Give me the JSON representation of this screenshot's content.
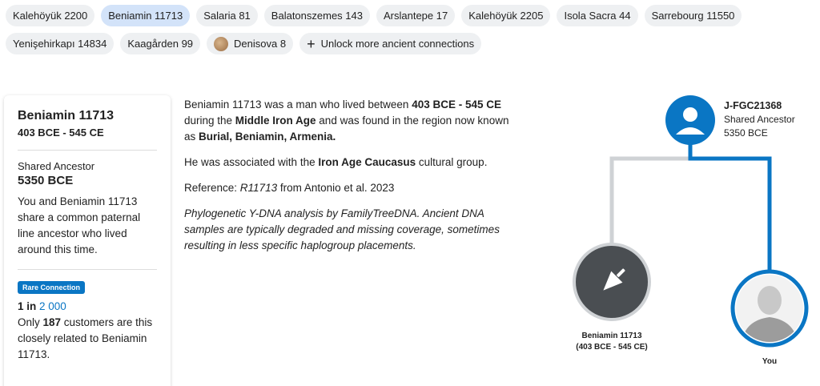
{
  "chips": {
    "row1": [
      "Kalehöyük 2200",
      "Beniamin 11713",
      "Salaria 81",
      "Balatonszemes 143",
      "Arslantepe 17",
      "Kalehöyük 2205",
      "Isola Sacra 44",
      "Sarrebourg 11550"
    ],
    "row2": [
      "Yenişehirkapı 14834",
      "Kaagården 99",
      "Denisova 8"
    ],
    "unlock_label": "Unlock more ancient connections"
  },
  "card": {
    "name": "Beniamin 11713",
    "dates": "403 BCE - 545 CE",
    "shared_label": "Shared Ancestor",
    "shared_value": "5350 BCE",
    "shared_text": "You and Beniamin 11713 share a common paternal line ancestor who lived around this time.",
    "badge": "Rare Connection",
    "ratio_prefix": "1 in ",
    "ratio_value": "2 000",
    "only_prefix": "Only ",
    "only_count": "187",
    "only_suffix": " customers are this closely related to Beniamin 11713."
  },
  "description": {
    "p1_a": "Beniamin 11713 was a man who lived between ",
    "p1_b": "403 BCE - 545 CE",
    "p1_c": " during the ",
    "p1_d": "Middle Iron Age",
    "p1_e": " and was found in the region now known as ",
    "p1_f": "Burial, Beniamin, Armenia.",
    "p2_a": "He was associated with the ",
    "p2_b": "Iron Age Caucasus",
    "p2_c": " cultural group.",
    "p3_a": "Reference: ",
    "p3_b": "R11713",
    "p3_c": " from Antonio et al. 2023",
    "p4": "Phylogenetic Y-DNA analysis by FamilyTreeDNA. Ancient DNA samples are typically degraded and missing coverage, sometimes resulting in less specific haplogroup placements."
  },
  "tree": {
    "ancestor_haplogroup": "J-FGC21368",
    "ancestor_label": "Shared Ancestor",
    "ancestor_date": "5350 BCE",
    "sample_name": "Beniamin 11713",
    "sample_dates": "(403 BCE - 545 CE)",
    "you_label": "You",
    "colors": {
      "accent": "#0a76c4",
      "gray_line": "#cfd2d5",
      "sample_bg": "#4a4e52"
    }
  }
}
